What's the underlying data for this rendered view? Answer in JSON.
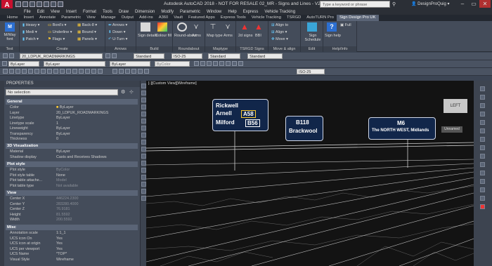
{
  "title": "Autodesk AutoCAD 2018 - NOT FOR RESALE   02_MR - Signs and Lines - V2-0.dwg",
  "search_placeholder": "Type a keyword or phrase",
  "user": "DesignProQuig",
  "menu": [
    "File",
    "Edit",
    "View",
    "Insert",
    "Format",
    "Tools",
    "Draw",
    "Dimension",
    "Modify",
    "Parametric",
    "Window",
    "Help",
    "Express",
    "Vehicle Tracking"
  ],
  "tabs": [
    "Home",
    "Insert",
    "Annotate",
    "Parametric",
    "View",
    "Manage",
    "Output",
    "Add-ins",
    "A360",
    "Vault",
    "Featured Apps",
    "Express Tools",
    "Vehicle Tracking",
    "TSRGD",
    "AutoTURN Pro",
    "Sign Design Pro UK"
  ],
  "active_tab": "Sign Design Pro UK",
  "ribbon": {
    "text_group": {
      "label": "Text",
      "btn": "M/Way font"
    },
    "create_group": {
      "label": "Create",
      "items": [
        "Heavy",
        "Medi",
        "Patch",
        "Bord's",
        "Underline",
        "Flags",
        "Back-8",
        "Bound",
        "Panels"
      ]
    },
    "arrows_group": {
      "label": "Arrows",
      "items": [
        "Arrows",
        "Down",
        "U-Turn"
      ]
    },
    "build_group": {
      "label": "Build",
      "items": [
        "Sign details",
        "Colour fill"
      ]
    },
    "roundabout_group": {
      "label": "Roundabout",
      "items": [
        "Round-about",
        "Arms"
      ]
    },
    "maptype_group": {
      "label": "Maptype",
      "items": [
        "Map type",
        "Arms"
      ]
    },
    "tsrgd_group": {
      "label": "TSRGD Signs",
      "items": [
        "2d signs",
        "BBI"
      ]
    },
    "move_group": {
      "label": "Move & align",
      "items": [
        "Align to",
        "Align",
        "Move"
      ]
    },
    "edit_group": {
      "label": "Edit",
      "items": [
        "Sign Schedule"
      ]
    },
    "help_group": {
      "label": "Help/Info",
      "items": [
        "Sign help",
        "Full"
      ]
    }
  },
  "toolbar": {
    "layer": "20_LDPUK_ROADMARKINGS",
    "style1": "Standard",
    "scale1": "ISO-25",
    "style2": "Standard",
    "style3": "Standard",
    "bylayer": "ByLayer",
    "linetype": "ByLayer",
    "lineweight": "ByLayer",
    "color": "ByColor",
    "iso": "ISO-25"
  },
  "properties": {
    "header": "PROPERTIES",
    "selection": "No selection",
    "sections": {
      "general": "General",
      "viz": "3D Visualization",
      "plot": "Plot style",
      "view": "View",
      "misc": "Misc"
    },
    "general": [
      [
        "Color",
        "ByLayer"
      ],
      [
        "Layer",
        "20_LDPUK_ROADMARKINGS"
      ],
      [
        "Linetype",
        "ByLayer"
      ],
      [
        "Linetype scale",
        "1"
      ],
      [
        "Lineweight",
        "ByLayer"
      ],
      [
        "Transparency",
        "ByLayer"
      ],
      [
        "Thickness",
        "0"
      ]
    ],
    "viz": [
      [
        "Material",
        "ByLayer"
      ],
      [
        "Shadow display",
        "Casts and Receives Shadows"
      ]
    ],
    "plot": [
      [
        "Plot style",
        "ByColor"
      ],
      [
        "Plot style table",
        "None"
      ],
      [
        "Plot table attache...",
        "Model"
      ],
      [
        "Plot table type",
        "Not available"
      ]
    ],
    "view": [
      [
        "Center X",
        "446224.2300"
      ],
      [
        "Center Y",
        "283280.4000"
      ],
      [
        "Center Z",
        "76.9181"
      ],
      [
        "Height",
        "81.5592"
      ],
      [
        "Width",
        "200.5592"
      ]
    ],
    "misc": [
      [
        "Annotation scale",
        "1:1_1"
      ],
      [
        "UCS icon On",
        "Yes"
      ],
      [
        "UCS icon at origin",
        "Yes"
      ],
      [
        "UCS per viewport",
        "Yes"
      ],
      [
        "UCS Name",
        "*TOP*"
      ],
      [
        "Visual Style",
        "Wireframe"
      ]
    ]
  },
  "viewport": {
    "label": "[-][Custom View][Wireframe]",
    "viewcube": "LEFT",
    "nav": "Unnamed",
    "sign1": {
      "l1": "Rickwell",
      "l1b": "A58",
      "l2": "Arnell",
      "l3": "Milford",
      "l3b": "B56"
    },
    "sign2": {
      "l1": "B118",
      "l2": "Brackwool"
    },
    "sign3": {
      "l1": "M6",
      "l2": "The NORTH WEST, Midlands"
    }
  }
}
